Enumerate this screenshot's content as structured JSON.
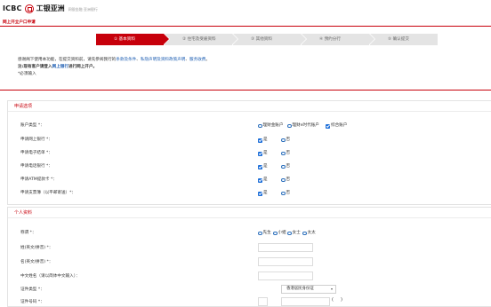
{
  "header": {
    "logo_text": "ICBC",
    "brand_name": "工银亚洲",
    "tagline": "网银金融 亚洲银行"
  },
  "title_bar": "网上开立户口申请",
  "steps": [
    {
      "label": "① 基本资料",
      "active": true
    },
    {
      "label": "② 住宅及受雇资料",
      "active": false
    },
    {
      "label": "③ 其他资料",
      "active": false
    },
    {
      "label": "④ 预约分行",
      "active": false
    },
    {
      "label": "⑤ 确认提交",
      "active": false
    }
  ],
  "intro": {
    "line1_prefix": "感谢阁下使用本功能，在提交资料前，请先参阅我行的",
    "link1": "条款及条件",
    "sep1": "、",
    "link2": "私隐声明及资料政策声明",
    "sep2": "、",
    "link3": "服务收费",
    "line1_suffix": "。",
    "line2_prefix": "注:现有客户请登入",
    "link4": "网上银行",
    "line2_suffix": "进行网上开户。",
    "required_note": "*必须输入"
  },
  "application_section": {
    "title": "申请选项",
    "rows": [
      {
        "label": "账户类型 *：",
        "options": [
          {
            "label": "理财金账户",
            "checked": false
          },
          {
            "label": "理财e时代账户",
            "checked": false
          },
          {
            "label": "综合账户",
            "checked": true
          }
        ]
      },
      {
        "label": "申请网上银行 *：",
        "options": [
          {
            "label": "是",
            "checked": true
          },
          {
            "label": "否",
            "checked": false
          }
        ]
      },
      {
        "label": "申请电子结单 *：",
        "options": [
          {
            "label": "是",
            "checked": true
          },
          {
            "label": "否",
            "checked": false
          }
        ]
      },
      {
        "label": "申请电话银行 *：",
        "options": [
          {
            "label": "是",
            "checked": true
          },
          {
            "label": "否",
            "checked": false
          }
        ]
      },
      {
        "label": "申请ATM提款卡 *：",
        "options": [
          {
            "label": "是",
            "checked": true
          },
          {
            "label": "否",
            "checked": false
          }
        ]
      },
      {
        "label": "申请支票簿（以平邮寄送）*：",
        "options": [
          {
            "label": "是",
            "checked": true
          },
          {
            "label": "否",
            "checked": false
          }
        ]
      }
    ]
  },
  "personal_section": {
    "title": "个人资料",
    "title_label": "称谓 *：",
    "title_options": [
      {
        "label": "先生",
        "checked": false
      },
      {
        "label": "小姐",
        "checked": false
      },
      {
        "label": "女士",
        "checked": false
      },
      {
        "label": "太太",
        "checked": false
      }
    ],
    "surname_label": "姓(英文/拼音) *：",
    "surname_value": "",
    "given_name_label": "名(英文/拼音) *：",
    "given_name_value": "",
    "chinese_name_label": "中文姓名（请以简体中文输入）：",
    "chinese_name_value": "",
    "id_type_label": "证件类型 *：",
    "id_type_value": "香港居民身份证",
    "id_number_label": "证件号码 *：",
    "id_number_value": "",
    "id_check_value": "",
    "paren_open": "(",
    "paren_close": ")"
  },
  "colors": {
    "brand_red": "#c7000b",
    "link_blue": "#1f5fb3",
    "step_inactive": "#e4e4e4"
  }
}
